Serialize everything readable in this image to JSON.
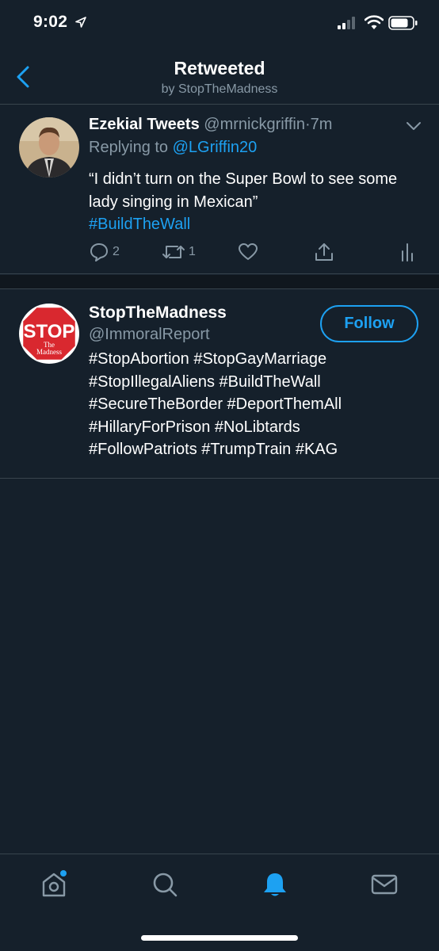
{
  "status_bar": {
    "time": "9:02"
  },
  "header": {
    "title": "Retweeted",
    "subtitle": "by StopTheMadness"
  },
  "tweet": {
    "author_name": "Ezekial Tweets",
    "author_handle": "@mrnickgriffin",
    "separator": "·",
    "time": "7m",
    "replying_label": "Replying to",
    "replying_handle": "@LGriffin20",
    "text": "“I didn’t turn on the Super Bowl to see some lady singing in Mexican”",
    "hashtag": "#BuildTheWall",
    "reply_count": "2",
    "retweet_count": "1"
  },
  "user_card": {
    "name": "StopTheMadness",
    "handle": "@ImmoralReport",
    "follow_label": "Follow",
    "bio_lines": [
      "#StopAbortion #StopGayMarriage",
      "#StopIllegalAliens #BuildTheWall",
      "#SecureTheBorder #DeportThemAll",
      "#HillaryForPrison #NoLibtards",
      "#FollowPatriots #TrumpTrain #KAG"
    ],
    "avatar_text": {
      "big": "STOP",
      "small_1": "The",
      "small_2": "Madness"
    }
  },
  "colors": {
    "background": "#15202b",
    "accent": "#1da1f2",
    "muted": "#8899a6",
    "divider": "#38444d"
  },
  "icons": {
    "tabs": [
      "home-icon",
      "search-icon",
      "notifications-icon",
      "messages-icon"
    ],
    "tweet_actions": [
      "reply-icon",
      "retweet-icon",
      "like-icon",
      "share-icon",
      "analytics-icon"
    ]
  }
}
